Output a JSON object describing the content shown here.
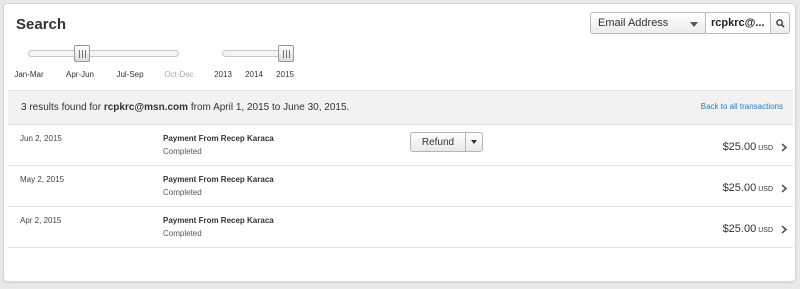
{
  "page": {
    "title": "Search"
  },
  "search": {
    "field_selected": "Email Address",
    "query_value": "rcpkrc@...",
    "search_icon": "search-icon"
  },
  "quarter_slider": {
    "labels": [
      "Jan-Mar",
      "Apr-Jun",
      "Jul-Sep",
      "Oct-Dec"
    ],
    "selected": "Apr-Jun",
    "disabled": [
      "Oct-Dec"
    ]
  },
  "year_slider": {
    "labels": [
      "2013",
      "2014",
      "2015"
    ],
    "selected": "2015"
  },
  "results": {
    "count_text": "3 results found for",
    "email": "rcpkrc@msn.com",
    "range_text": "from April 1, 2015 to June 30, 2015.",
    "back_link": "Back to all transactions"
  },
  "transactions": [
    {
      "date": "Jun 2, 2015",
      "payee": "Payment From Recep Karaca",
      "status": "Completed",
      "amount": "$25.00",
      "currency": "USD",
      "action": "Refund"
    },
    {
      "date": "May 2, 2015",
      "payee": "Payment From Recep Karaca",
      "status": "Completed",
      "amount": "$25.00",
      "currency": "USD"
    },
    {
      "date": "Apr 2, 2015",
      "payee": "Payment From Recep Karaca",
      "status": "Completed",
      "amount": "$25.00",
      "currency": "USD"
    }
  ],
  "colors": {
    "link": "#2a7bb8",
    "header_bg": "#f2f2f2",
    "page_bg": "#e9e9e9"
  }
}
